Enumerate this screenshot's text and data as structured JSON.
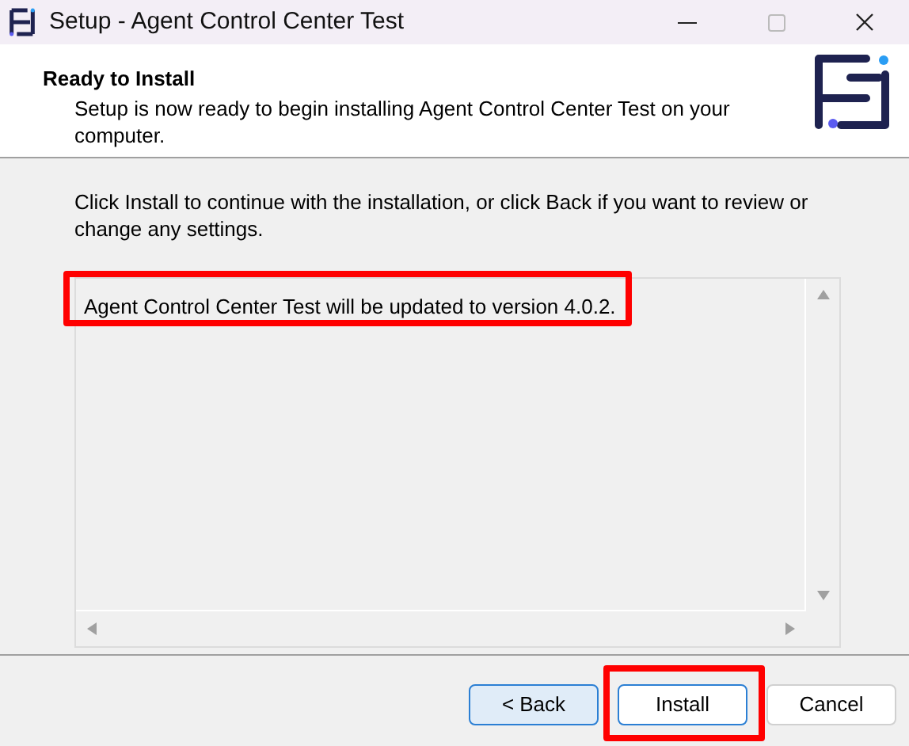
{
  "window": {
    "title": "Setup - Agent Control Center Test"
  },
  "header": {
    "title": "Ready to Install",
    "subtitle": "Setup is now ready to begin installing Agent Control Center Test on your computer."
  },
  "instructions": "Click Install to continue with the installation, or click Back if you want to review or change any settings.",
  "memo": {
    "text": "Agent Control Center Test will be updated to version 4.0.2.",
    "highlighted": true
  },
  "buttons": [
    {
      "label": "< Back",
      "kind": "back",
      "highlighted": false
    },
    {
      "label": "Install",
      "kind": "default",
      "highlighted": true
    },
    {
      "label": "Cancel",
      "kind": "plain",
      "highlighted": false
    }
  ]
}
